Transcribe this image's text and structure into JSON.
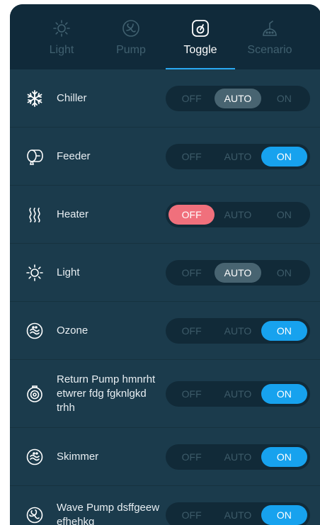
{
  "tabs": [
    {
      "label": "Light",
      "icon": "sun-icon",
      "active": false
    },
    {
      "label": "Pump",
      "icon": "pump-icon",
      "active": false
    },
    {
      "label": "Toggle",
      "icon": "toggle-icon",
      "active": true
    },
    {
      "label": "Scenario",
      "icon": "scenario-icon",
      "active": false
    }
  ],
  "options": {
    "off": "OFF",
    "auto": "AUTO",
    "on": "ON"
  },
  "colors": {
    "on": "#17a2ee",
    "auto": "#486471",
    "off": "#f0707c"
  },
  "devices": [
    {
      "name": "Chiller",
      "icon": "snowflake-icon",
      "state": "auto"
    },
    {
      "name": "Feeder",
      "icon": "feeder-icon",
      "state": "on"
    },
    {
      "name": "Heater",
      "icon": "heat-waves-icon",
      "state": "off"
    },
    {
      "name": "Light",
      "icon": "sun-icon",
      "state": "auto"
    },
    {
      "name": "Ozone",
      "icon": "ozone-icon",
      "state": "on"
    },
    {
      "name": "Return Pump hmnrht etwrer fdg fgknlgkd trhh",
      "icon": "return-pump-icon",
      "state": "on"
    },
    {
      "name": "Skimmer",
      "icon": "skimmer-icon",
      "state": "on"
    },
    {
      "name": "Wave Pump dsffgeew efhehkg",
      "icon": "wave-pump-icon",
      "state": "on"
    }
  ]
}
